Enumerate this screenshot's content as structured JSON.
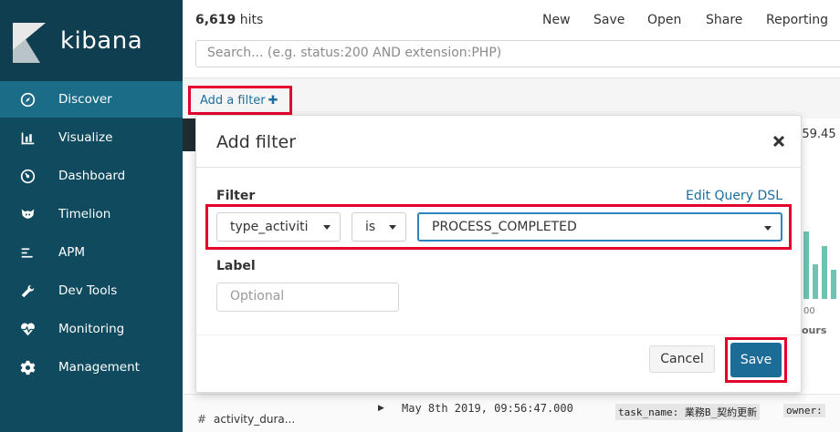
{
  "app": {
    "logo_text": "kibana"
  },
  "sidebar": {
    "items": [
      {
        "label": "Discover",
        "icon": "compass-icon",
        "active": true
      },
      {
        "label": "Visualize",
        "icon": "bar-chart-icon"
      },
      {
        "label": "Dashboard",
        "icon": "dashboard-icon"
      },
      {
        "label": "Timelion",
        "icon": "timelion-icon"
      },
      {
        "label": "APM",
        "icon": "apm-icon"
      },
      {
        "label": "Dev Tools",
        "icon": "wrench-icon"
      },
      {
        "label": "Monitoring",
        "icon": "heartbeat-icon"
      },
      {
        "label": "Management",
        "icon": "gear-icon"
      }
    ]
  },
  "header": {
    "hits_count": "6,619",
    "hits_suffix": " hits",
    "menu": [
      "New",
      "Save",
      "Open",
      "Share",
      "Reporting"
    ],
    "search_placeholder": "Search... (e.g. status:200 AND extension:PHP)"
  },
  "filterbar": {
    "add_filter_label": "Add a filter",
    "plus": "✚"
  },
  "background": {
    "time_fragment": ":59.45",
    "axis_fragment": "00",
    "hours_fragment": "ours",
    "field_hash": "#",
    "field_name": "activity_dura...",
    "doc_date": "May 8th 2019, 09:56:47.000",
    "doc_tag1": "task_name: 業務B_契約更新",
    "doc_tag2": "owner:",
    "chart_color": "#6ec3b1"
  },
  "modal": {
    "title": "Add filter",
    "filter_label": "Filter",
    "edit_dsl": "Edit Query DSL",
    "field_value": "type_activiti",
    "operator_value": "is",
    "value_value": "PROCESS_COMPLETED",
    "label_heading": "Label",
    "label_placeholder": "Optional",
    "cancel_label": "Cancel",
    "save_label": "Save"
  },
  "colors": {
    "sidebar_bg": "#0f4a5e",
    "sidebar_active": "#1b6c87",
    "link": "#1b6ea0",
    "primary_button": "#1b6c96",
    "highlight_frame": "#e5002b"
  }
}
